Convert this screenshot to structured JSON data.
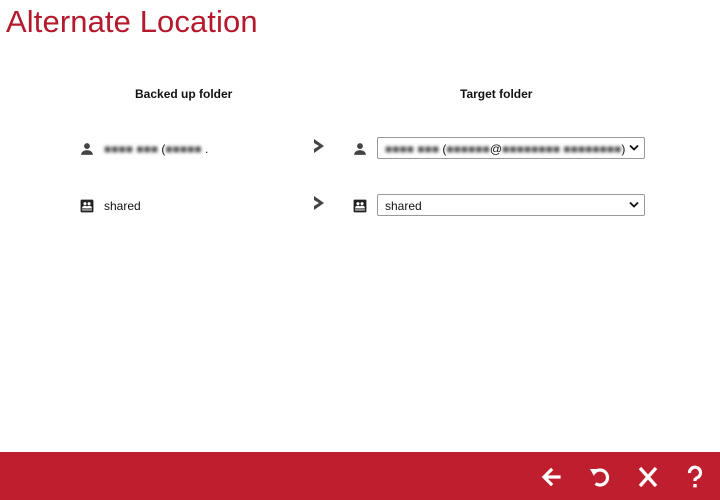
{
  "page": {
    "title": "Alternate Location"
  },
  "columns": {
    "backed_up": "Backed up folder",
    "target": "Target folder"
  },
  "rows": [
    {
      "source_icon": "user-icon",
      "source_name_blurred": "■■■■ ■■■",
      "source_open": "(",
      "source_email_blurred": "■■■■■",
      "source_suffix": ".",
      "target_icon": "user-icon",
      "target_name_blurred": "■■■■ ■■■",
      "target_open": "(",
      "target_email_blurred": "■■■■■■",
      "target_at": "@",
      "target_domain_blurred": "■■■■■■■■ ■■■■■■■■",
      "target_close": ")"
    },
    {
      "source_icon": "shared-folder-icon",
      "source_label": "shared",
      "target_icon": "shared-folder-icon",
      "target_value": "shared"
    }
  ],
  "footer": {
    "back": "arrow-left-icon",
    "undo": "undo-icon",
    "close": "close-icon",
    "help": "help-icon",
    "accent": "#be1e2d"
  },
  "colors": {
    "title": "#b5192d",
    "footer": "#be1e2d"
  }
}
